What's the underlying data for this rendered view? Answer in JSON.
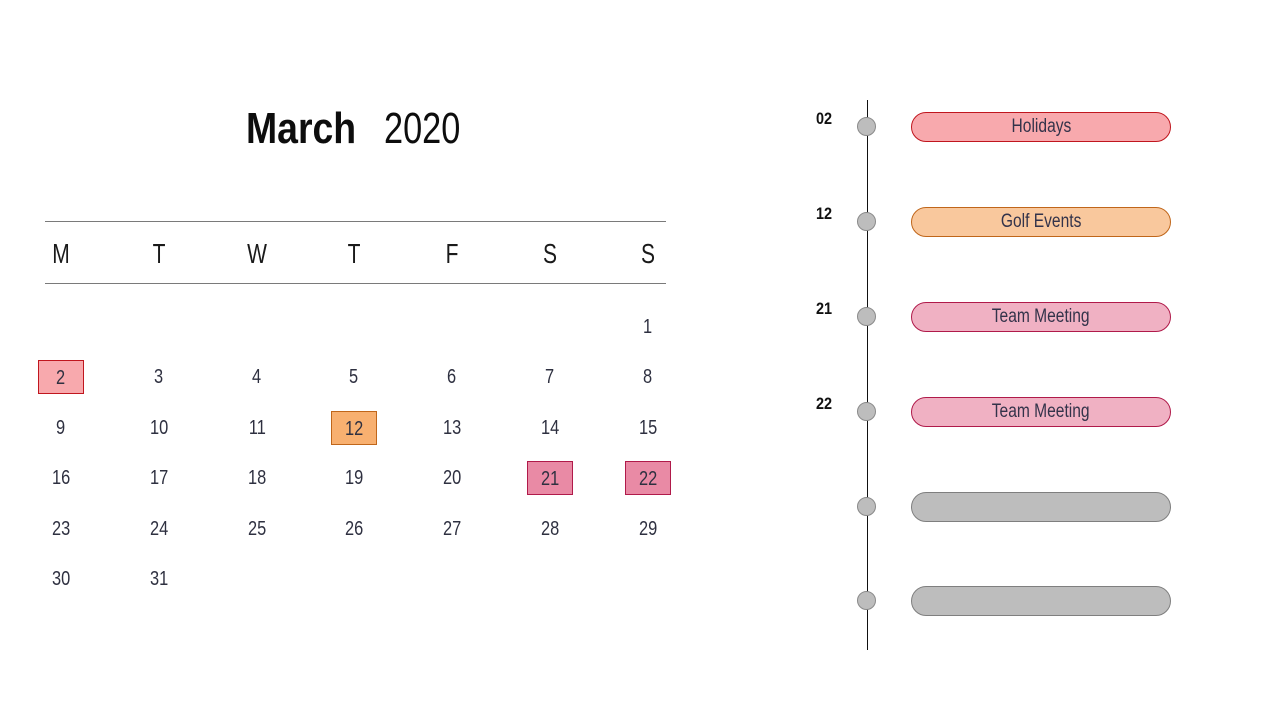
{
  "calendar": {
    "month": "March",
    "year": "2020",
    "weekdays": [
      "M",
      "T",
      "W",
      "T",
      "F",
      "S",
      "S"
    ],
    "weeks": [
      [
        "",
        "",
        "",
        "",
        "",
        "",
        "1"
      ],
      [
        "2",
        "3",
        "4",
        "5",
        "6",
        "7",
        "8"
      ],
      [
        "9",
        "10",
        "11",
        "12",
        "13",
        "14",
        "15"
      ],
      [
        "16",
        "17",
        "18",
        "19",
        "20",
        "21",
        "22"
      ],
      [
        "23",
        "24",
        "25",
        "26",
        "27",
        "28",
        "29"
      ],
      [
        "30",
        "31",
        "",
        "",
        "",
        "",
        ""
      ]
    ],
    "highlights": {
      "2": {
        "fill": "#f8a9ad",
        "border": "#c0161e"
      },
      "12": {
        "fill": "#f8b070",
        "border": "#c0661a"
      },
      "21": {
        "fill": "#e98aa5",
        "border": "#b01a4a"
      },
      "22": {
        "fill": "#e98aa5",
        "border": "#b01a4a"
      }
    }
  },
  "timeline": {
    "events": [
      {
        "date": "02",
        "label": "Holidays",
        "fill": "#f8a9ad",
        "border": "#c0161e"
      },
      {
        "date": "12",
        "label": "Golf Events",
        "fill": "#f9c89d",
        "border": "#c0661a"
      },
      {
        "date": "21",
        "label": "Team Meeting",
        "fill": "#f0b1c3",
        "border": "#b01a4a"
      },
      {
        "date": "22",
        "label": "Team Meeting",
        "fill": "#f0b1c3",
        "border": "#b01a4a"
      },
      {
        "date": "",
        "label": "",
        "fill": "#bdbdbd",
        "border": "#7f7f7f"
      },
      {
        "date": "",
        "label": "",
        "fill": "#bdbdbd",
        "border": "#7f7f7f"
      }
    ]
  }
}
